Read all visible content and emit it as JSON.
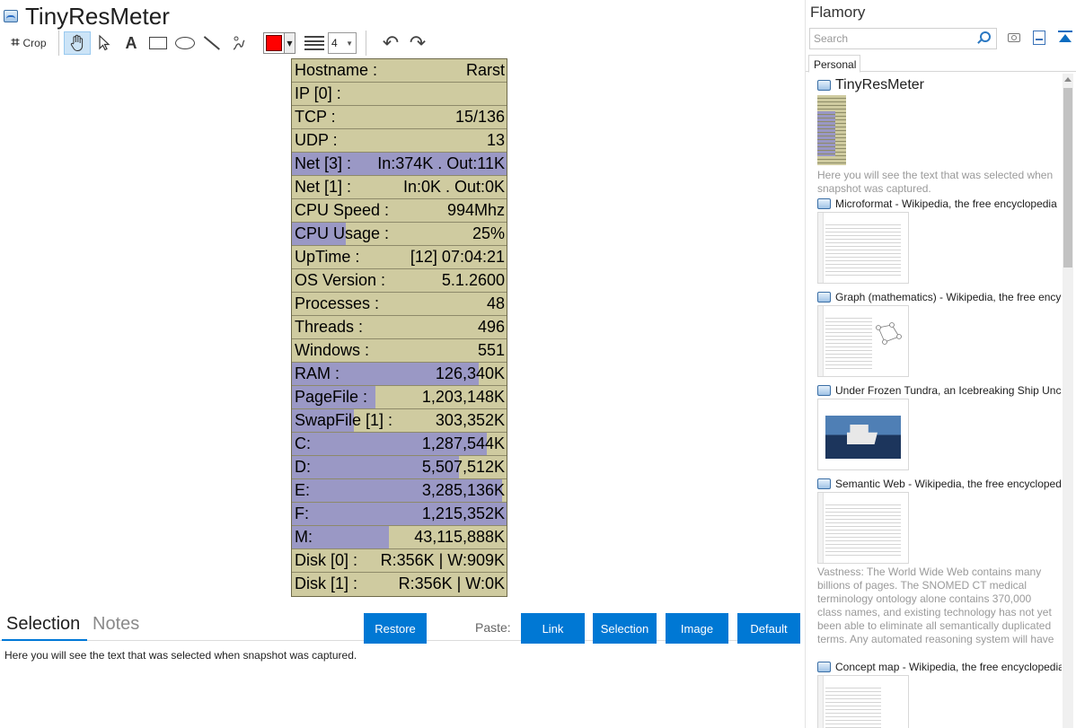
{
  "app": {
    "title": "TinyResMeter"
  },
  "toolbar": {
    "crop_label": "Crop",
    "line_width": "4"
  },
  "capture": {
    "rows": [
      {
        "label": "Hostname :",
        "value": "Rarst",
        "fill": 0
      },
      {
        "label": "IP [0] :",
        "value": "",
        "fill": 0
      },
      {
        "label": "TCP :",
        "value": "15/136",
        "fill": 0
      },
      {
        "label": "UDP :",
        "value": "13",
        "fill": 0
      },
      {
        "label": "Net [3] :",
        "value": "In:374K . Out:11K",
        "fill": 1.0
      },
      {
        "label": "Net [1] :",
        "value": "In:0K . Out:0K",
        "fill": 0
      },
      {
        "label": "CPU Speed :",
        "value": "994Mhz",
        "fill": 0
      },
      {
        "label": "CPU Usage :",
        "value": "25%",
        "fill": 0.25
      },
      {
        "label": "UpTime :",
        "value": "[12] 07:04:21",
        "fill": 0
      },
      {
        "label": "OS Version :",
        "value": "5.1.2600",
        "fill": 0
      },
      {
        "label": "Processes :",
        "value": "48",
        "fill": 0
      },
      {
        "label": "Threads :",
        "value": "496",
        "fill": 0
      },
      {
        "label": "Windows :",
        "value": "551",
        "fill": 0
      },
      {
        "label": "RAM :",
        "value": "126,340K",
        "fill": 0.87
      },
      {
        "label": "PageFile :",
        "value": "1,203,148K",
        "fill": 0.39
      },
      {
        "label": "SwapFile [1] :",
        "value": "303,352K",
        "fill": 0.29
      },
      {
        "label": "C:",
        "value": "1,287,544K",
        "fill": 0.91
      },
      {
        "label": "D:",
        "value": "5,507,512K",
        "fill": 0.78
      },
      {
        "label": "E:",
        "value": "3,285,136K",
        "fill": 0.98
      },
      {
        "label": "F:",
        "value": "1,215,352K",
        "fill": 1.0
      },
      {
        "label": "M:",
        "value": "43,115,888K",
        "fill": 0.45
      },
      {
        "label": "Disk [0] :",
        "value": "R:356K | W:909K",
        "fill": 0
      },
      {
        "label": "Disk [1] :",
        "value": "R:356K | W:0K",
        "fill": 0
      }
    ]
  },
  "bottom": {
    "tab_selection": "Selection",
    "tab_notes": "Notes",
    "restore": "Restore",
    "paste_label": "Paste:",
    "link": "Link",
    "selection": "Selection",
    "image": "Image",
    "default": "Default",
    "selection_text": "Here you will see the text that was selected when snapshot was captured."
  },
  "sidebar": {
    "title": "Flamory",
    "search_placeholder": "Search",
    "tab": "Personal",
    "items": [
      {
        "title": "TinyResMeter",
        "desc": "Here you will see the text that was selected when snapshot was captured."
      },
      {
        "title": "Microformat - Wikipedia, the free encyclopedia"
      },
      {
        "title": "Graph (mathematics) - Wikipedia, the free ency"
      },
      {
        "title": "Under Frozen Tundra, an Icebreaking Ship Unco"
      },
      {
        "title": "Semantic Web - Wikipedia, the free encycloped",
        "desc": "Vastness: The World Wide Web contains many billions of pages. The SNOMED CT medical terminology ontology alone contains 370,000 class names, and existing technology has not yet been able to eliminate all semantically duplicated terms. Any automated reasoning system will have to deal with truly huge inputs."
      },
      {
        "title": "Concept map - Wikipedia, the free encyclopedia"
      }
    ]
  },
  "colors": {
    "accent": "#0078d4",
    "meter_bg": "#cfcba0",
    "meter_fill": "#9a98c5",
    "pen": "#ff0000"
  }
}
